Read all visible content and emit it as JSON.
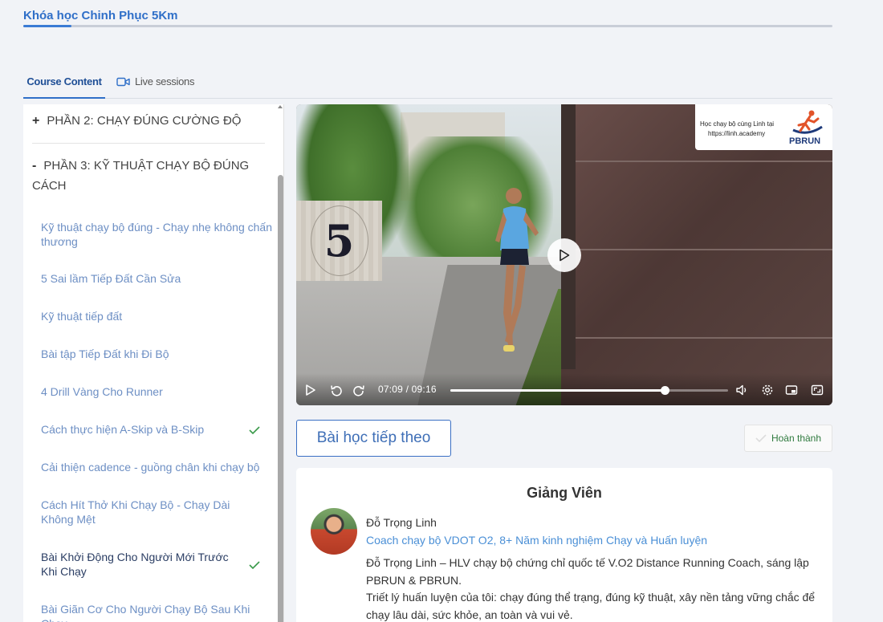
{
  "course": {
    "title": "Khóa học Chinh Phục 5Km",
    "progress_percent": 6
  },
  "tabs": [
    {
      "label": "Course Content",
      "active": true
    },
    {
      "label": "Live sessions",
      "icon": "video-camera-icon"
    }
  ],
  "sidebar": {
    "sections": [
      {
        "sign": "+",
        "title": "PHẦN 2: CHẠY ĐÚNG CƯỜNG ĐỘ"
      },
      {
        "sign": "-",
        "title": "PHẦN 3: KỸ THUẬT CHẠY BỘ ĐÚNG CÁCH"
      }
    ],
    "lessons": [
      {
        "title": "Kỹ thuật chạy bộ đúng - Chạy nhẹ không chấn thương",
        "completed": false
      },
      {
        "title": "5 Sai lầm Tiếp Đất Cần Sửa",
        "completed": false
      },
      {
        "title": "Kỹ thuật tiếp đất",
        "completed": false
      },
      {
        "title": "Bài tập Tiếp Đất khi Đi Bộ",
        "completed": false
      },
      {
        "title": "4 Drill Vàng Cho Runner",
        "completed": false
      },
      {
        "title": "Cách thực hiện A-Skip và B-Skip",
        "completed": true
      },
      {
        "title": "Cải thiện cadence - guồng chân khi chạy bộ",
        "completed": false
      },
      {
        "title": "Cách Hít Thở Khi Chạy Bộ - Chạy Dài Không Mệt",
        "completed": false
      },
      {
        "title": "Bài Khởi Động Cho Người Mới Trước Khi Chạy",
        "completed": true,
        "current": true
      },
      {
        "title": "Bài Giãn Cơ Cho Người Chạy Bộ Sau Khi Chạy",
        "completed": false
      }
    ]
  },
  "video": {
    "overlay_number": "5",
    "watermark_line1": "Học chạy bộ cùng Linh tại",
    "watermark_line2": "https://linh.academy",
    "watermark_brand": "PBRUN",
    "current_time": "07:09",
    "separator": "/",
    "duration": "09:16",
    "progress_fraction": 0.772
  },
  "actions": {
    "next_label": "Bài học tiếp theo",
    "complete_label": "Hoàn thành"
  },
  "instructor": {
    "heading": "Giảng Viên",
    "name": "Đỗ Trọng Linh",
    "role": "Coach chạy bộ VDOT O2, 8+ Năm kinh nghiệm Chạy và Huấn luyện",
    "bio_line1": "Đỗ Trọng Linh – HLV chạy bộ chứng chỉ quốc tế V.O2 Distance Running Coach, sáng lập PBRUN & PBRUN.",
    "bio_line2": "Triết lý huấn luyện của tôi: chạy đúng thể trạng, đúng kỹ thuật, xây nền tảng vững chắc để chạy lâu dài, sức khỏe, an toàn và vui vẻ."
  },
  "colors": {
    "accent": "#2f6fc8",
    "lesson_link": "#6d8fc4",
    "check": "#3a9a4a"
  }
}
